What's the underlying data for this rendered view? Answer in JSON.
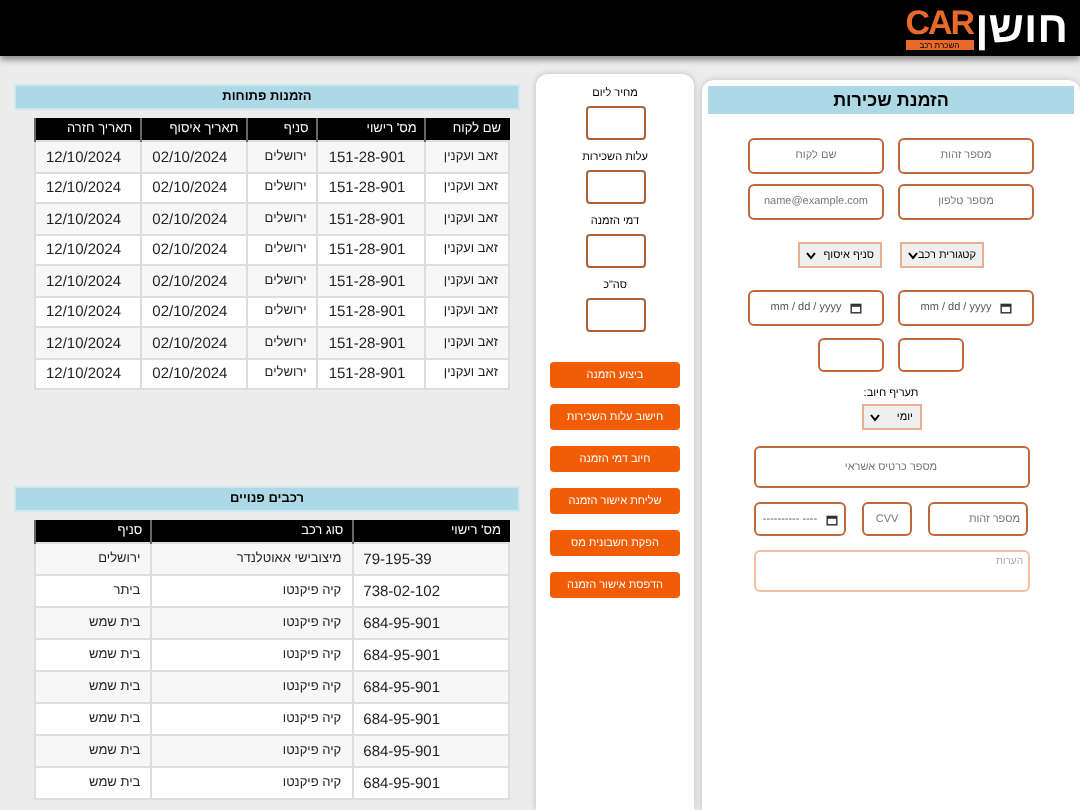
{
  "header": {
    "logo_main": "חושן",
    "logo_accent": "CAR",
    "logo_tagline": "השכרת רכב"
  },
  "open_orders": {
    "title": "הזמנות פתוחות",
    "columns": [
      "שם לקוח",
      "מס' רישוי",
      "סניף",
      "תאריך איסוף",
      "תאריך חזרה"
    ],
    "rows": [
      [
        "זאב ועקנין",
        "151-28-901",
        "ירושלים",
        "02/10/2024",
        "12/10/2024"
      ],
      [
        "זאב ועקנין",
        "151-28-901",
        "ירושלים",
        "02/10/2024",
        "12/10/2024"
      ],
      [
        "זאב ועקנין",
        "151-28-901",
        "ירושלים",
        "02/10/2024",
        "12/10/2024"
      ],
      [
        "זאב ועקנין",
        "151-28-901",
        "ירושלים",
        "02/10/2024",
        "12/10/2024"
      ],
      [
        "זאב ועקנין",
        "151-28-901",
        "ירושלים",
        "02/10/2024",
        "12/10/2024"
      ],
      [
        "זאב ועקנין",
        "151-28-901",
        "ירושלים",
        "02/10/2024",
        "12/10/2024"
      ],
      [
        "זאב ועקנין",
        "151-28-901",
        "ירושלים",
        "02/10/2024",
        "12/10/2024"
      ],
      [
        "זאב ועקנין",
        "151-28-901",
        "ירושלים",
        "02/10/2024",
        "12/10/2024"
      ]
    ]
  },
  "free_cars": {
    "title": "רכבים פנויים",
    "columns": [
      "מס' רישוי",
      "סוג רכב",
      "סניף"
    ],
    "rows": [
      [
        "79-195-39",
        "מיצובישי אאוטלנדר",
        "ירושלים"
      ],
      [
        "738-02-102",
        "קיה פיקנטו",
        "ביתר"
      ],
      [
        "684-95-901",
        "קיה פיקנטו",
        "בית שמש"
      ],
      [
        "684-95-901",
        "קיה פיקנטו",
        "בית שמש"
      ],
      [
        "684-95-901",
        "קיה פיקנטו",
        "בית שמש"
      ],
      [
        "684-95-901",
        "קיה פיקנטו",
        "בית שמש"
      ],
      [
        "684-95-901",
        "קיה פיקנטו",
        "בית שמש"
      ],
      [
        "684-95-901",
        "קיה פיקנטו",
        "בית שמש"
      ]
    ]
  },
  "summary": {
    "fields": [
      {
        "label": "מחיר ליום"
      },
      {
        "label": "עלות השכירות"
      },
      {
        "label": "דמי הזמנה"
      },
      {
        "label": "סה\"כ"
      }
    ],
    "buttons": [
      "ביצוע הזמנה",
      "חישוב עלות השכירות",
      "חיוב דמי הזמנה",
      "שליחת אישור הזמנה",
      "הפקת חשבונית מס",
      "הדפסת אישור הזמנה"
    ]
  },
  "rental_form": {
    "title": "הזמנת שכירות",
    "id_field": {
      "placeholder": "מספר זהות"
    },
    "name_field": {
      "placeholder": "שם לקוח"
    },
    "phone_field": {
      "placeholder": "מספר טלפון"
    },
    "email_field": {
      "placeholder": "name@example.com"
    },
    "category_select": {
      "value": "קטגורית רכב"
    },
    "branch_select": {
      "value": "סניף איסוף"
    },
    "pickup_date": {
      "value": "mm / dd / yyyy"
    },
    "return_date": {
      "value": "mm / dd / yyyy"
    },
    "rate_label": "תעריף חיוב:",
    "rate_select": {
      "value": "יומי"
    },
    "card_field": {
      "placeholder": "מספר כרטיס אשראי"
    },
    "card_id_field": {
      "placeholder": "מספר זהות"
    },
    "cvv_field": {
      "placeholder": "CVV"
    },
    "expiry_field": {
      "value": "---------- ----"
    },
    "notes_field": {
      "placeholder": "הערות"
    }
  }
}
